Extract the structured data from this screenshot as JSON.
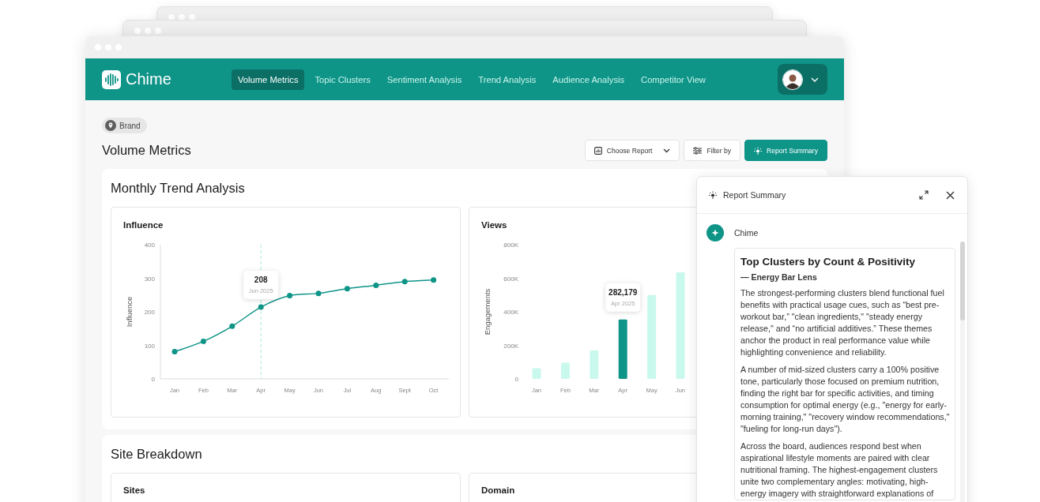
{
  "app": {
    "logo": "Chime",
    "nav": [
      {
        "label": "Volume Metrics",
        "selected": true
      },
      {
        "label": "Topic Clusters",
        "selected": false
      },
      {
        "label": "Sentiment Analysis",
        "selected": false
      },
      {
        "label": "Trend Analysis",
        "selected": false
      },
      {
        "label": "Audience Analysis",
        "selected": false
      },
      {
        "label": "Competitor View",
        "selected": false
      }
    ]
  },
  "page": {
    "chip": "Brand",
    "title": "Volume Metrics",
    "actions": [
      {
        "label": "Choose Report",
        "kind": "dropdown"
      },
      {
        "label": "Filter by",
        "kind": "filter"
      },
      {
        "label": "Report Summary",
        "kind": "primary"
      }
    ]
  },
  "trend_section": {
    "title": "Monthly Trend Analysis",
    "charts": [
      {
        "title": "Influence",
        "tooltip": {
          "value": "208",
          "date": "Jun 2025"
        },
        "chart_data": {
          "type": "line",
          "ylabel": "Influence",
          "categories": [
            "Jan",
            "Feb",
            "Mar",
            "Apr",
            "May",
            "Jun",
            "Jul",
            "Aug",
            "Sept",
            "Oct"
          ],
          "series": [
            {
              "color": "#0f9488",
              "marker": "circle",
              "values": [
                81,
                112,
                157,
                214,
                248,
                255,
                269,
                279,
                290,
                295
              ]
            }
          ],
          "ylim": [
            0,
            400
          ],
          "yticks": [
            0,
            100,
            200,
            300,
            400
          ],
          "ref_lines": [
            {
              "axis": "x",
              "value": "Apr",
              "color": "#a8e8da"
            }
          ]
        }
      },
      {
        "title": "Views",
        "tooltip": {
          "value": "282,179",
          "date": "Apr 2025"
        },
        "chart_data": {
          "type": "bar",
          "ylabel": "Engagements",
          "categories": [
            "Jan",
            "Feb",
            "Mar",
            "Apr",
            "May",
            "Jun"
          ],
          "series": [
            {
              "color": "#c9f8ed",
              "values": [
                64000,
                97000,
                170000,
                null,
                500000,
                635000
              ]
            },
            {
              "color": "#0f9488",
              "values": [
                null,
                null,
                null,
                354000,
                null,
                null
              ]
            }
          ],
          "ylim": [
            0,
            800000
          ],
          "yticks": [
            {
              "value": 0,
              "label": "0"
            },
            {
              "value": 200000,
              "label": "200K"
            },
            {
              "value": 400000,
              "label": "400K"
            },
            {
              "value": 600000,
              "label": "600K"
            },
            {
              "value": 800000,
              "label": "800K"
            }
          ]
        }
      }
    ]
  },
  "site_section": {
    "title": "Site Breakdown",
    "cards": [
      {
        "title": "Sites"
      },
      {
        "title": "Domain"
      }
    ]
  },
  "summary_panel": {
    "title": "Report Summary",
    "sender": "Chime",
    "heading": "Top Clusters by Count & Positivity",
    "subheading": "— Energy Bar Lens",
    "paragraphs": [
      "The strongest-performing clusters blend functional fuel benefits with practical usage cues, such as “best pre-workout bar,” \"clean ingredients,\" \"steady energy release,\" and “no artificial additives.” These themes anchor the product in real performance value while highlighting convenience and reliability.",
      "A number of mid-sized clusters carry a 100% positive tone, particularly those focused on premium nutrition, finding the right bar for specific activities, and timing consumption for optimal energy (e.g., \"energy for early-morning training,\" \"recovery window recommendations,\" \"fueling for long-run days\").",
      "Across the board, audiences respond best when aspirational lifestyle moments are paired with clear nutritional framing. The highest-engagement clusters unite two complementary angles: motivating, high-energy imagery with straightforward explanations of"
    ]
  }
}
